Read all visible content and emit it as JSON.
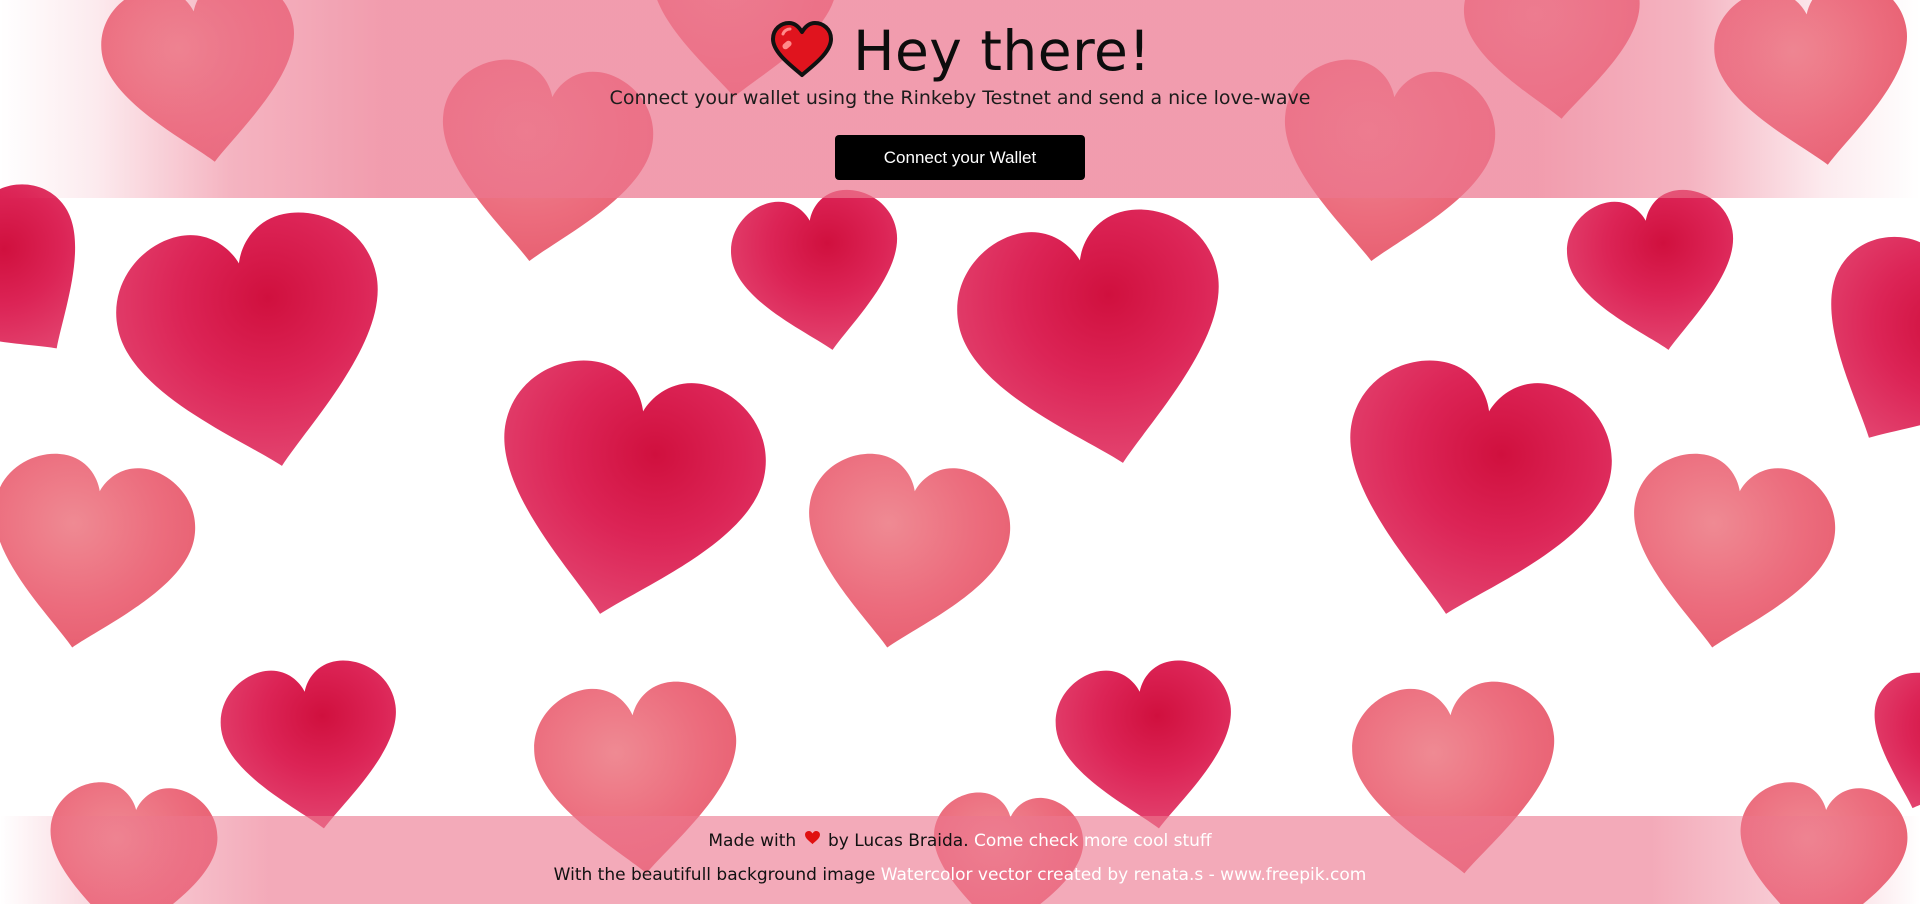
{
  "header": {
    "title": "Hey there!",
    "title_icon": "red-heart-emoji",
    "subtitle": "Connect your wallet using the Rinkeby Testnet and send a nice love-wave",
    "connect_button_label": "Connect your Wallet"
  },
  "footer": {
    "made_with_prefix": "Made with",
    "heart_icon": "heart-icon",
    "author_text": "by Lucas Braida.",
    "author_link_text": "Come check more cool stuff",
    "background_credit_prefix": "With the beautifull background image",
    "background_credit_link_text": "Watercolor vector created by renata.s - www.freepik.com"
  },
  "colors": {
    "header_overlay": "#EC768E",
    "button_background": "#000000",
    "button_text": "#FFFFFF",
    "link_text": "#FFFFFF",
    "heart_dark": "#D9184F",
    "heart_light": "#EE7080"
  }
}
